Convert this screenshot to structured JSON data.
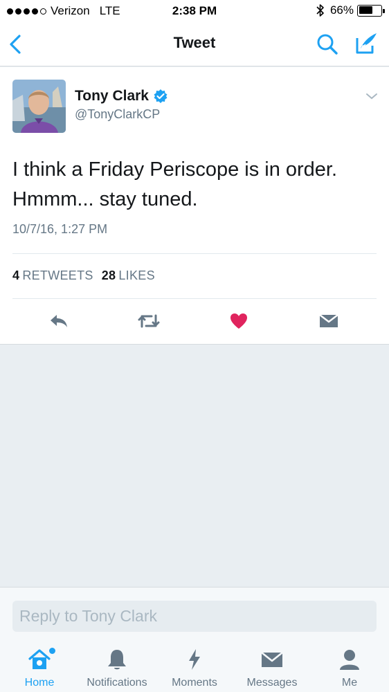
{
  "status_bar": {
    "carrier": "Verizon",
    "network": "LTE",
    "time": "2:38 PM",
    "battery_percent": "66%",
    "battery_level": 0.66,
    "signal_bars": 4
  },
  "nav": {
    "title": "Tweet",
    "icons": [
      "chevron-left-icon",
      "search-icon",
      "compose-icon"
    ]
  },
  "tweet": {
    "author_name": "Tony Clark",
    "author_handle": "@TonyClarkCP",
    "verified": true,
    "text": "I think a Friday Periscope is in order. Hmmm... stay tuned.",
    "timestamp": "10/7/16, 1:27 PM",
    "retweets_count": "4",
    "retweets_label": "RETWEETS",
    "likes_count": "28",
    "likes_label": "LIKES",
    "liked": true
  },
  "reply": {
    "placeholder": "Reply to Tony Clark"
  },
  "tabs": [
    {
      "label": "Home",
      "icon": "home-icon",
      "active": true
    },
    {
      "label": "Notifications",
      "icon": "bell-icon",
      "active": false
    },
    {
      "label": "Moments",
      "icon": "lightning-icon",
      "active": false
    },
    {
      "label": "Messages",
      "icon": "envelope-icon",
      "active": false
    },
    {
      "label": "Me",
      "icon": "person-icon",
      "active": false
    }
  ],
  "colors": {
    "accent": "#1da1f2",
    "like": "#e0245e",
    "muted": "#657786",
    "text": "#14171a",
    "background": "#e9eef2"
  }
}
